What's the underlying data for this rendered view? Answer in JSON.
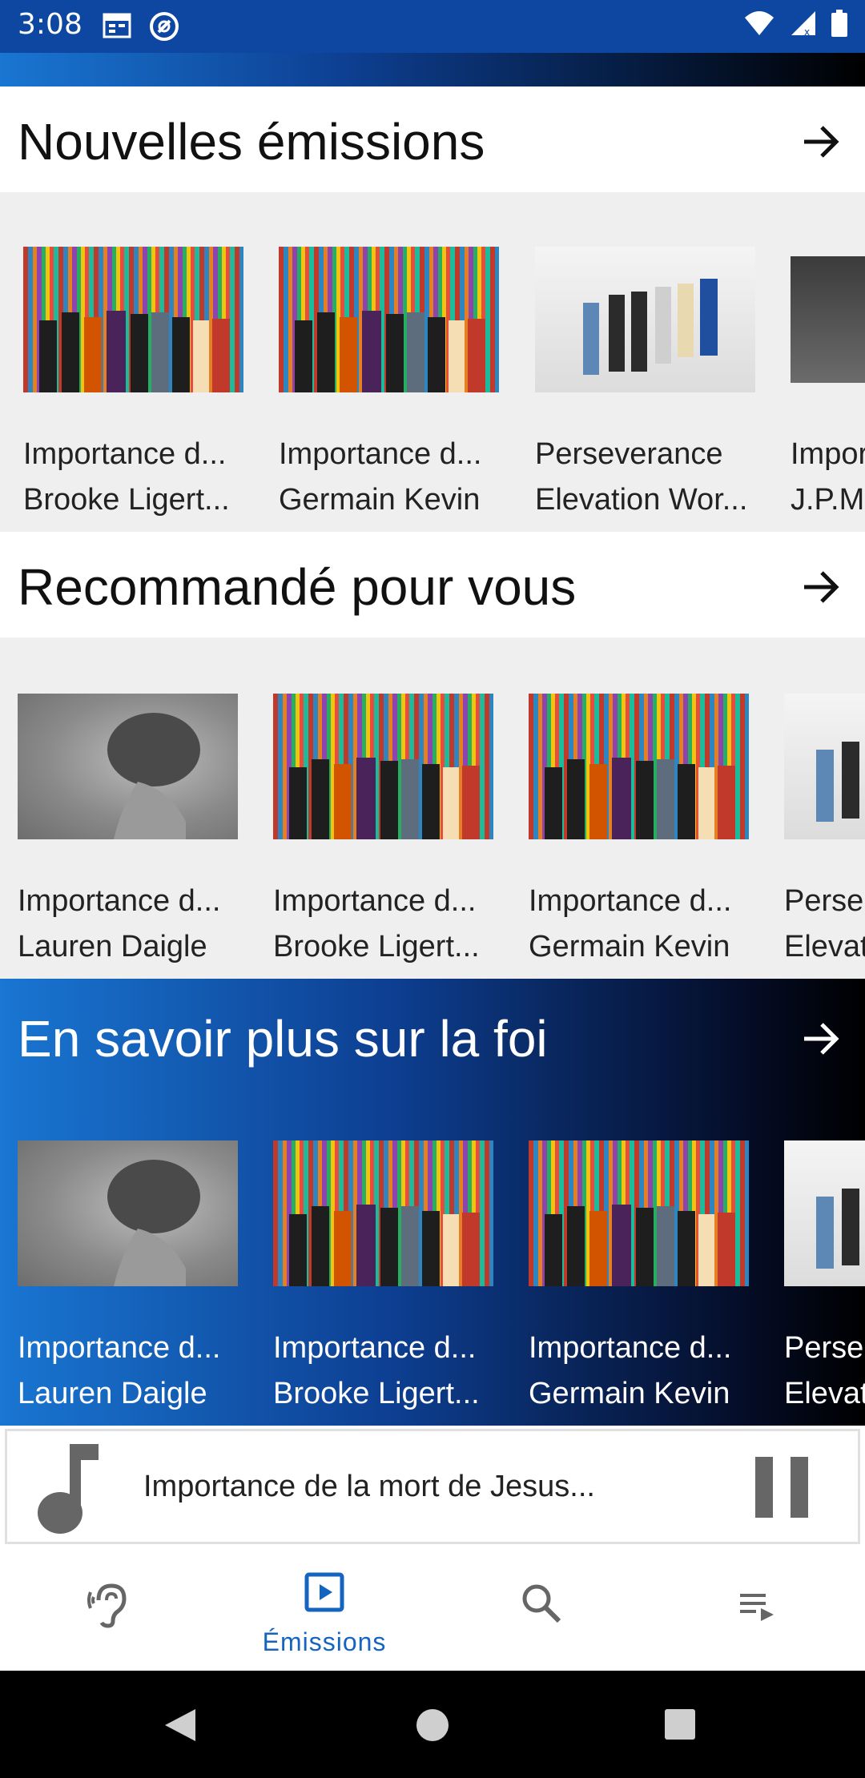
{
  "status_bar": {
    "time": "3:08"
  },
  "sections": {
    "new": {
      "title": "Nouvelles émissions",
      "items": [
        {
          "title": "Importance d...",
          "subtitle": "Brooke Ligert..."
        },
        {
          "title": "Importance d...",
          "subtitle": "Germain Kevin"
        },
        {
          "title": "Perseverance",
          "subtitle": "Elevation Wor..."
        },
        {
          "title": "Impor",
          "subtitle": "J.P.M"
        }
      ]
    },
    "recommended": {
      "title": "Recommandé pour vous",
      "items": [
        {
          "title": "Importance d...",
          "subtitle": "Lauren Daigle"
        },
        {
          "title": "Importance d...",
          "subtitle": "Brooke Ligert..."
        },
        {
          "title": "Importance d...",
          "subtitle": "Germain Kevin"
        },
        {
          "title": "Perse",
          "subtitle": "Elevat"
        }
      ]
    },
    "faith": {
      "title": "En savoir plus sur la foi",
      "items": [
        {
          "title": "Importance d...",
          "subtitle": "Lauren Daigle"
        },
        {
          "title": "Importance d...",
          "subtitle": "Brooke Ligert..."
        },
        {
          "title": "Importance d...",
          "subtitle": "Germain Kevin"
        },
        {
          "title": "Perse",
          "subtitle": "Elevat"
        }
      ]
    }
  },
  "player": {
    "title": "Importance de la mort de Jesus...",
    "icon": "music-note-icon",
    "control": "pause-icon"
  },
  "bottom_nav": {
    "items": [
      {
        "icon": "ear-icon",
        "label": ""
      },
      {
        "icon": "play-box-icon",
        "label": "Émissions",
        "selected": true
      },
      {
        "icon": "search-icon",
        "label": ""
      },
      {
        "icon": "playlist-icon",
        "label": ""
      }
    ]
  },
  "colors": {
    "accent": "#1565c0",
    "status_bar": "#0d47a1",
    "gradient_start": "#1976d2",
    "gradient_end": "#000000"
  }
}
